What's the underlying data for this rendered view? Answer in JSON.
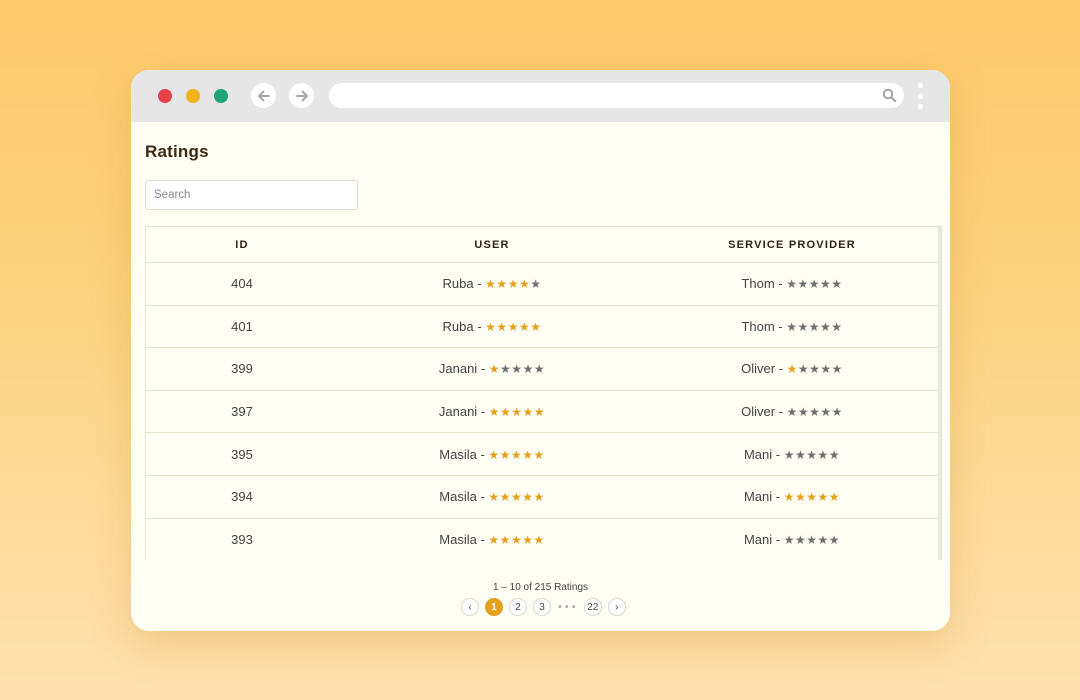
{
  "page": {
    "title": "Ratings"
  },
  "search": {
    "placeholder": "Search"
  },
  "table": {
    "columns": {
      "id": "ID",
      "user": "USER",
      "service_provider": "SERVICE PROVIDER"
    },
    "rows": [
      {
        "id": "404",
        "user": "Ruba",
        "user_rating": 4,
        "provider": "Thom",
        "provider_rating": 0
      },
      {
        "id": "401",
        "user": "Ruba",
        "user_rating": 5,
        "provider": "Thom",
        "provider_rating": 0
      },
      {
        "id": "399",
        "user": "Janani",
        "user_rating": 1,
        "provider": "Oliver",
        "provider_rating": 1
      },
      {
        "id": "397",
        "user": "Janani",
        "user_rating": 5,
        "provider": "Oliver",
        "provider_rating": 0
      },
      {
        "id": "395",
        "user": "Masila",
        "user_rating": 5,
        "provider": "Mani",
        "provider_rating": 0
      },
      {
        "id": "394",
        "user": "Masila",
        "user_rating": 5,
        "provider": "Mani",
        "provider_rating": 5
      },
      {
        "id": "393",
        "user": "Masila",
        "user_rating": 5,
        "provider": "Mani",
        "provider_rating": 0
      }
    ],
    "max_rating": 5
  },
  "pagination": {
    "summary": "1 – 10 of 215 Ratings",
    "prev": "‹",
    "next": "›",
    "pages": [
      "1",
      "2",
      "3"
    ],
    "ellipsis": "•••",
    "last_page": "22",
    "current": "1"
  },
  "colors": {
    "star_on": "#e5a11e",
    "star_off": "#6f6f6f",
    "accent": "#e5a11e",
    "close": "#e8414c",
    "minimize": "#f2b21b",
    "maximize": "#20a57b"
  },
  "icons": {
    "back": "arrow-left-icon",
    "forward": "arrow-right-icon",
    "search": "search-icon",
    "menu": "kebab-menu-icon",
    "star": "star-icon"
  }
}
